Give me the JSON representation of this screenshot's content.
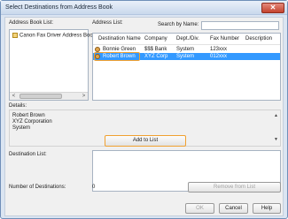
{
  "window": {
    "title": "Select Destinations from Address Book",
    "close_glyph": "✕"
  },
  "address_book": {
    "label": "Address Book List:",
    "items": [
      "Canon Fax Driver Address Book"
    ],
    "scroll_left": "<",
    "scroll_right": ">"
  },
  "address_list": {
    "label": "Address List:",
    "search_label": "Search by Name:",
    "search_value": "",
    "columns": [
      "Destination Name",
      "Company",
      "Dept./Div.",
      "Fax Number",
      "Description"
    ],
    "rows": [
      {
        "name": "Bonnie Green",
        "company": "$$$ Bank",
        "dept": "System",
        "fax": "123xxx",
        "description": "",
        "selected": false
      },
      {
        "name": "Robert Brown",
        "company": "XYZ Corp",
        "dept": "System",
        "fax": "012xxx",
        "description": "",
        "selected": true
      }
    ]
  },
  "details": {
    "label": "Details:",
    "lines": [
      "Robert Brown",
      "XYZ Corporation",
      "System"
    ]
  },
  "actions": {
    "add_to_list": "Add to List",
    "remove_from_list": "Remove from List",
    "ok": "OK",
    "cancel": "Cancel",
    "help": "Help"
  },
  "destination_list": {
    "label": "Destination List:",
    "count_label": "Number of Destinations:",
    "count_value": "0"
  },
  "colors": {
    "selection": "#3399ff",
    "focus_highlight": "#f0a030"
  }
}
